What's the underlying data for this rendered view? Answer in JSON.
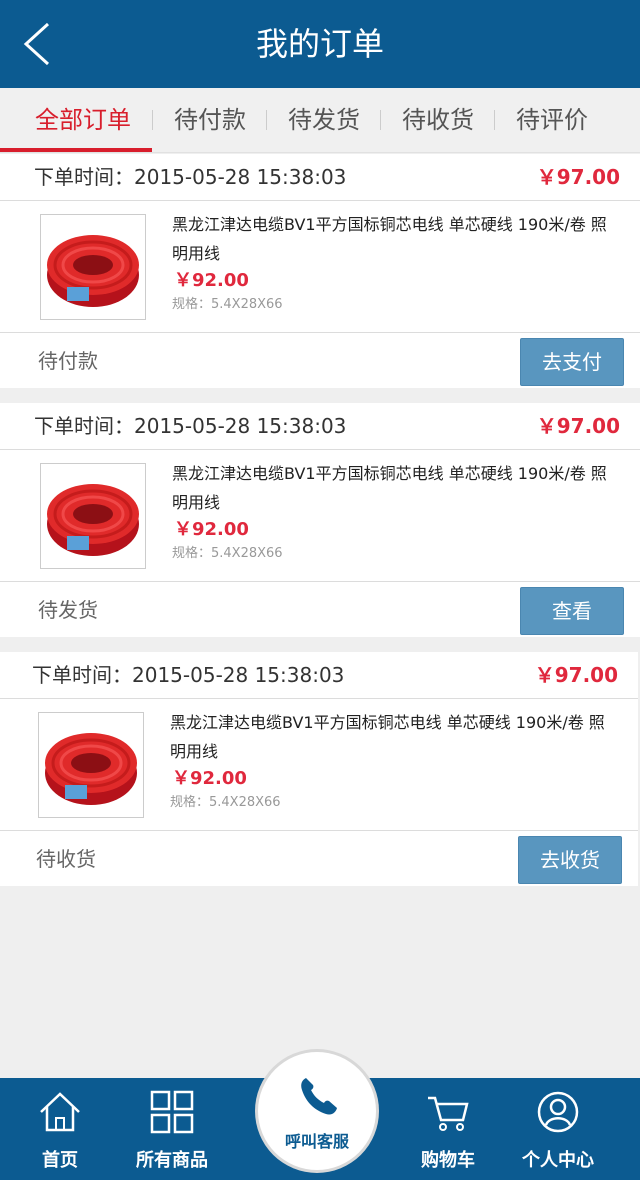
{
  "header": {
    "title": "我的订单",
    "back_icon": "chevron-left-icon"
  },
  "tabs": [
    {
      "label": "全部订单",
      "active": true
    },
    {
      "label": "待付款"
    },
    {
      "label": "待发货"
    },
    {
      "label": "待收货"
    },
    {
      "label": "待评价"
    }
  ],
  "orders": [
    {
      "time": "下单时间：2015-05-28 15:38:03",
      "total": "￥97.00",
      "product_name": "黑龙江津达电缆BV1平方国标铜芯电线 单芯硬线 190米/卷 照明用线",
      "price": "￥92.00",
      "spec": "规格：5.4X28X66",
      "status": "待付款",
      "action": "去支付"
    },
    {
      "time": "下单时间：2015-05-28 15:38:03",
      "total": "￥97.00",
      "product_name": "黑龙江津达电缆BV1平方国标铜芯电线 单芯硬线 190米/卷 照明用线",
      "price": "￥92.00",
      "spec": "规格：5.4X28X66",
      "status": "待发货",
      "action": "查看"
    },
    {
      "time": "下单时间：2015-05-28 15:38:03",
      "total": "￥97.00",
      "product_name": "黑龙江津达电缆BV1平方国标铜芯电线 单芯硬线 190米/卷 照明用线",
      "price": "￥92.00",
      "spec": "规格：5.4X28X66",
      "status": "待收货",
      "action": "去收货"
    }
  ],
  "bottom_nav": {
    "home": "首页",
    "all_products": "所有商品",
    "call_service": "呼叫客服",
    "cart": "购物车",
    "profile": "个人中心"
  },
  "colors": {
    "header_bg": "#0c5b91",
    "accent_red": "#e0283d",
    "button_bg": "#5996bf"
  }
}
